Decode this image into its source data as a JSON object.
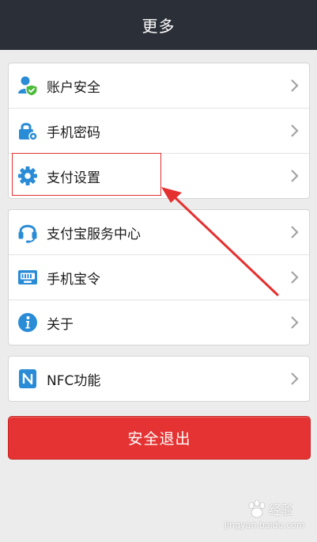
{
  "header": {
    "title": "更多"
  },
  "groups": [
    {
      "items": [
        {
          "label": "账户安全",
          "icon": "user-shield-icon"
        },
        {
          "label": "手机密码",
          "icon": "phone-lock-icon"
        },
        {
          "label": "支付设置",
          "icon": "gear-icon"
        }
      ]
    },
    {
      "items": [
        {
          "label": "支付宝服务中心",
          "icon": "headset-icon"
        },
        {
          "label": "手机宝令",
          "icon": "token-card-icon"
        },
        {
          "label": "关于",
          "icon": "info-icon"
        }
      ]
    },
    {
      "items": [
        {
          "label": "NFC功能",
          "icon": "nfc-icon"
        }
      ]
    }
  ],
  "logout": {
    "label": "安全退出"
  },
  "annotation": {
    "highlighted_item": "支付设置",
    "color": "#e53030"
  },
  "watermark": {
    "text": "jingyan.baidu.com"
  },
  "colors": {
    "header_bg": "#2b2f37",
    "accent_blue": "#2a8bd6",
    "logout_red": "#e53333"
  }
}
